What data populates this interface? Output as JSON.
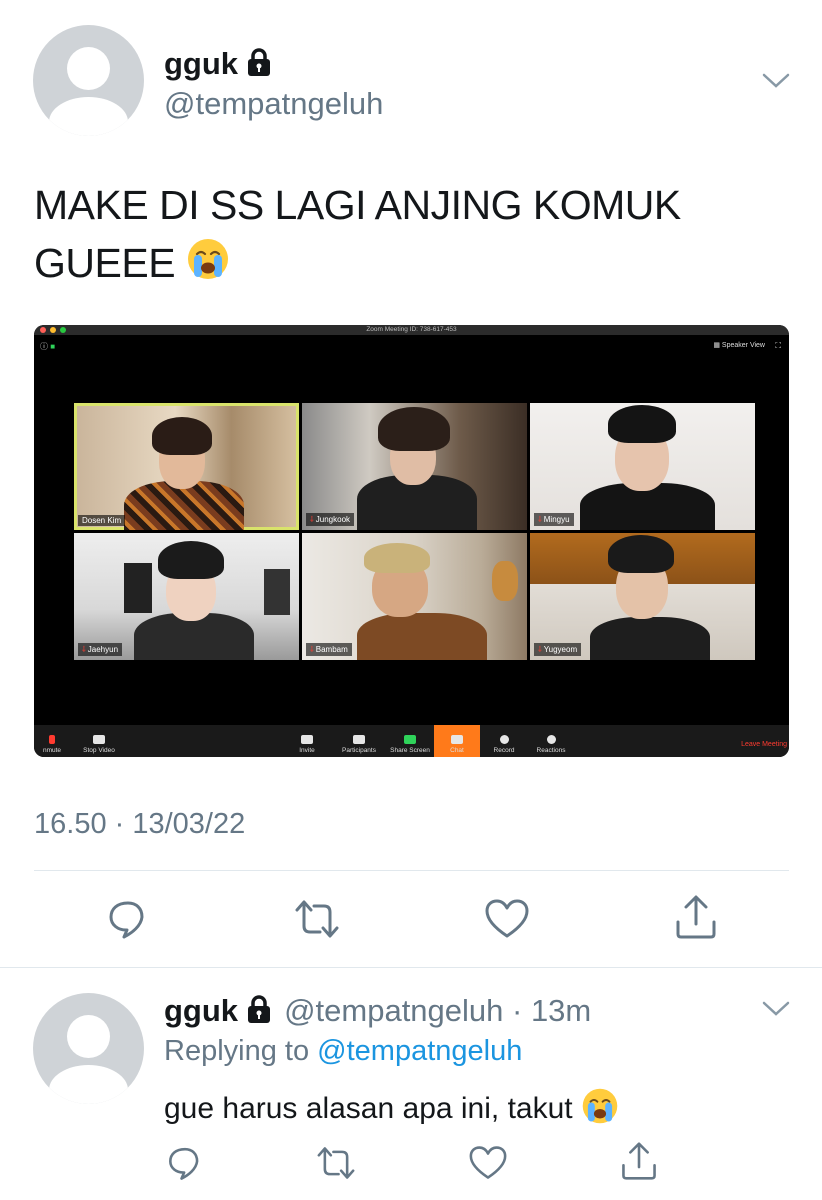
{
  "tweet": {
    "display_name": "gguk",
    "handle": "@tempatngeluh",
    "text_line1": "MAKE DI SS LAGI ANJING KOMUK",
    "text_line2": "GUEEE",
    "timestamp": "16.50 · 13/03/22",
    "colors": {
      "text": "#14171a",
      "secondary": "#657786",
      "link": "#1b95e0",
      "divider": "#e1e8ed"
    }
  },
  "zoom": {
    "title": "Zoom Meeting ID: 738-617-453",
    "view_label": "Speaker View",
    "participants": [
      {
        "name": "Dosen Kim",
        "muted": false,
        "active": true
      },
      {
        "name": "Jungkook",
        "muted": true,
        "active": false
      },
      {
        "name": "Mingyu",
        "muted": true,
        "active": false
      },
      {
        "name": "Jaehyun",
        "muted": true,
        "active": false
      },
      {
        "name": "Bambam",
        "muted": true,
        "active": false
      },
      {
        "name": "Yugyeom",
        "muted": true,
        "active": false
      }
    ],
    "toolbar": {
      "unmute": "nmute",
      "stop_video": "Stop Video",
      "invite": "Invite",
      "participants": "Participants",
      "participants_count": "6",
      "share_screen": "Share Screen",
      "chat": "Chat",
      "chat_count": "1",
      "record": "Record",
      "reactions": "Reactions",
      "leave": "Leave Meeting"
    }
  },
  "reply": {
    "display_name": "gguk",
    "handle_time": "@tempatngeluh · 13m",
    "replying_prefix": "Replying to",
    "replying_to": "@tempatngeluh",
    "text": "gue harus alasan apa ini, takut"
  },
  "icons": [
    "lock-icon",
    "chevron-down-icon",
    "reply-icon",
    "retweet-icon",
    "like-icon",
    "share-icon",
    "crying-emoji-icon"
  ]
}
